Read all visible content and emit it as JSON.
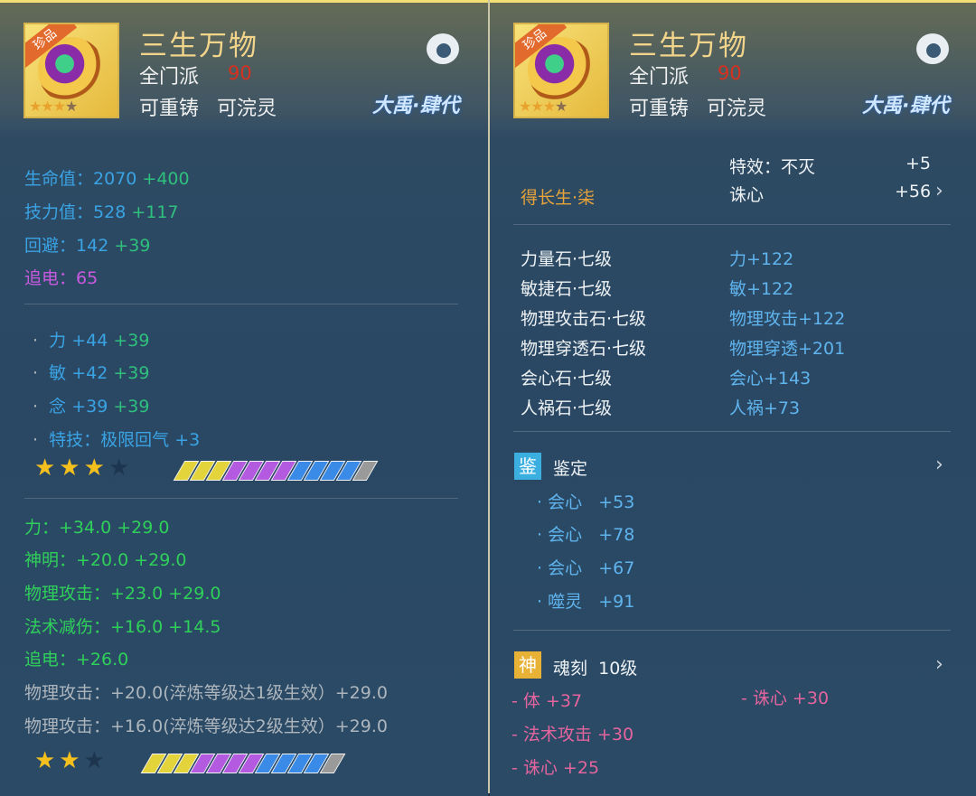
{
  "left": {
    "item": {
      "name": "三生万物",
      "badge": "珍品",
      "sect": "全门派",
      "level": "90",
      "tag1": "可重铸",
      "tag2": "可浣灵",
      "brand": "大禹·肆代"
    },
    "stats": [
      {
        "label": "生命值：",
        "value": "2070",
        "bonus": "+400"
      },
      {
        "label": "技力值：",
        "value": "528",
        "bonus": "+117"
      },
      {
        "label": "回避：",
        "value": "142",
        "bonus": "+39"
      },
      {
        "label": "追电：",
        "value": "65",
        "bonus": ""
      }
    ],
    "attrs": [
      {
        "bullet": "·",
        "label": "力",
        "value": "+44",
        "bonus": "+39"
      },
      {
        "bullet": "·",
        "label": "敏",
        "value": "+42",
        "bonus": "+39"
      },
      {
        "bullet": "·",
        "label": "念",
        "value": "+39",
        "bonus": "+39"
      },
      {
        "bullet": "·",
        "label": "特技：极限回气",
        "value": "+3",
        "bonus": ""
      }
    ],
    "star_row1": {
      "stars_filled": 3,
      "stars_total": 4
    },
    "refine": [
      {
        "text": "力：+34.0 +29.0"
      },
      {
        "text": "神明：+20.0 +29.0"
      },
      {
        "text": "物理攻击：+23.0 +29.0"
      },
      {
        "text": "法术减伤：+16.0 +14.5"
      },
      {
        "text": "追电：+26.0"
      }
    ],
    "refine_gray": [
      {
        "text": "物理攻击：+20.0(淬炼等级达1级生效）+29.0"
      },
      {
        "text": "物理攻击：+16.0(淬炼等级达2级生效）+29.0"
      }
    ],
    "star_row2": {
      "stars_filled": 2,
      "stars_total": 3
    }
  },
  "right": {
    "item": {
      "name": "三生万物",
      "badge": "珍品",
      "sect": "全门派",
      "level": "90",
      "tag1": "可重铸",
      "tag2": "可浣灵",
      "brand": "大禹·肆代"
    },
    "effect_name": "得长生·柒",
    "effects": [
      {
        "label": "特效：不灭",
        "value": "+5"
      },
      {
        "label": "诛心",
        "value": "+56"
      }
    ],
    "stones": [
      {
        "name": "力量石·七级",
        "bonus": "力+122"
      },
      {
        "name": "敏捷石·七级",
        "bonus": "敏+122"
      },
      {
        "name": "物理攻击石·七级",
        "bonus": "物理攻击+122"
      },
      {
        "name": "物理穿透石·七级",
        "bonus": "物理穿透+201"
      },
      {
        "name": "会心石·七级",
        "bonus": "会心+143"
      },
      {
        "name": "人祸石·七级",
        "bonus": "人祸+73"
      }
    ],
    "appraise": {
      "icon": "鉴",
      "title": "鉴定",
      "lines": [
        {
          "bullet": "·",
          "label": "会心",
          "value": "+53"
        },
        {
          "bullet": "·",
          "label": "会心",
          "value": "+78"
        },
        {
          "bullet": "·",
          "label": "会心",
          "value": "+67"
        },
        {
          "bullet": "·",
          "label": "噬灵",
          "value": "+91"
        }
      ]
    },
    "soul": {
      "icon": "神",
      "title": "魂刻",
      "level": "10级",
      "left": [
        {
          "text": "- 体 +37"
        },
        {
          "text": "- 法术攻击 +30"
        },
        {
          "text": "- 诛心 +25"
        }
      ],
      "right": [
        {
          "text": "- 诛心 +30"
        }
      ]
    }
  },
  "colors": {
    "accent_gold": "#f2d48a",
    "hp_blue": "#3aa3e4",
    "bonus_green": "#2fd05a",
    "purple": "#c85ae0",
    "pink": "#e4659e"
  },
  "gems1": [
    "#e2d43a",
    "#e2d43a",
    "#e2d43a",
    "#b45ae0",
    "#b45ae0",
    "#b45ae0",
    "#b45ae0",
    "#3a8ae8",
    "#3a8ae8",
    "#3a8ae8",
    "#3a8ae8",
    "#9a9a9a"
  ],
  "gems2": [
    "#e2d43a",
    "#e2d43a",
    "#e2d43a",
    "#b45ae0",
    "#b45ae0",
    "#b45ae0",
    "#b45ae0",
    "#3a8ae8",
    "#3a8ae8",
    "#3a8ae8",
    "#3a8ae8",
    "#9a9a9a"
  ]
}
